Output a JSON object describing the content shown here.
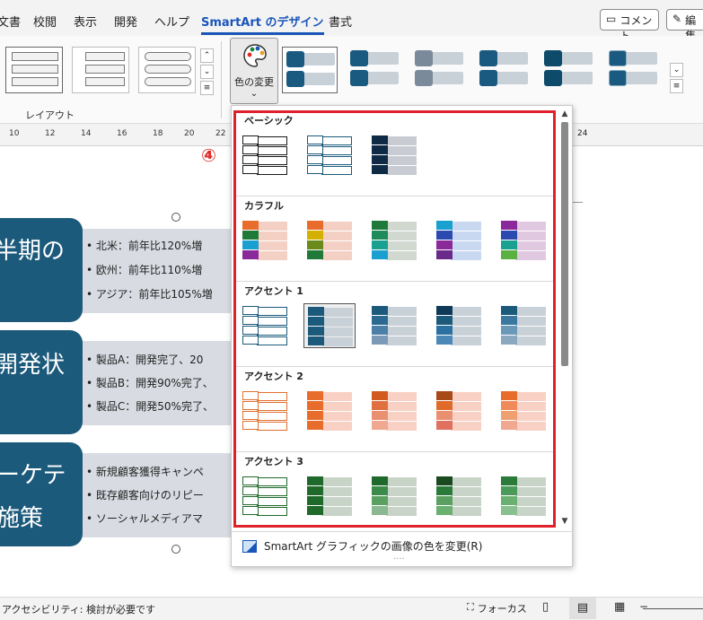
{
  "ribbon_tabs": [
    {
      "label": "文書",
      "active": false
    },
    {
      "label": "校閲",
      "active": false
    },
    {
      "label": "表示",
      "active": false
    },
    {
      "label": "開発",
      "active": false
    },
    {
      "label": "ヘルプ",
      "active": false
    },
    {
      "label": "SmartArt のデザイン",
      "active": true
    },
    {
      "label": "書式",
      "active": false
    }
  ],
  "comment_button": "コメント",
  "edit_button": "編集",
  "layout_group_label": "レイアウト",
  "color_change_button": "色の変更",
  "step_marker": "④",
  "ruler_ticks": [
    "10",
    "12",
    "14",
    "16",
    "18",
    "20",
    "22",
    "24"
  ],
  "document": {
    "blocks": [
      {
        "title_lines": [
          "半期の",
          ""
        ],
        "bullets": [
          "• 北米：前年比120%増",
          "• 欧州：前年比110%増",
          "• アジア：前年比105%増"
        ]
      },
      {
        "title_lines": [
          "開発状",
          ""
        ],
        "bullets": [
          "• 製品A：開発完了、20",
          "• 製品B：開発90%完了、",
          "• 製品C：開発50%完了、"
        ]
      },
      {
        "title_lines": [
          "ーケテ",
          "施策"
        ],
        "bullets": [
          "• 新規顧客獲得キャンペ",
          "• 既存顧客向けのリピー",
          "• ソーシャルメディアマ"
        ]
      }
    ]
  },
  "color_menu": {
    "sections": [
      {
        "title": "ベーシック",
        "options": [
          {
            "dark": "#ffffff",
            "light": "#ffffff",
            "border": "#1a1a1a",
            "rows": [
              "#ffffff",
              "#ffffff",
              "#ffffff",
              "#ffffff"
            ]
          },
          {
            "dark": "#ffffff",
            "light": "#ffffff",
            "border": "#1c5a7c",
            "rows": [
              "#ffffff",
              "#ffffff",
              "#ffffff",
              "#ffffff"
            ]
          },
          {
            "dark": "#0e2a44",
            "light": "#c8ccd2",
            "border": "none",
            "rows": [
              "#0e2a44",
              "#0e2a44",
              "#0e2a44",
              "#0e2a44"
            ]
          }
        ]
      },
      {
        "title": "カラフル",
        "options": [
          {
            "light": "#f4d0c4",
            "border": "none",
            "rows": [
              "#e86c2c",
              "#1f7a3a",
              "#1aa0d0",
              "#8a2a9a"
            ]
          },
          {
            "light": "#f4d0c4",
            "border": "none",
            "rows": [
              "#e86c2c",
              "#d4b000",
              "#6a8a1a",
              "#1f7a3a"
            ]
          },
          {
            "light": "#d0d8d0",
            "border": "none",
            "rows": [
              "#1f7a3a",
              "#1f8a5a",
              "#1aa090",
              "#1aa0d0"
            ]
          },
          {
            "light": "#c8d8f0",
            "border": "none",
            "rows": [
              "#1aa0d0",
              "#2a4ab0",
              "#8a2a9a",
              "#6a2a8a"
            ]
          },
          {
            "light": "#e0c8e0",
            "border": "none",
            "rows": [
              "#8a2a9a",
              "#2a4ab0",
              "#1aa090",
              "#5ab040"
            ]
          }
        ]
      },
      {
        "title": "アクセント 1",
        "options": [
          {
            "light": "#ffffff",
            "border": "#1c5a7c",
            "rows": [
              "#ffffff",
              "#ffffff",
              "#ffffff",
              "#ffffff"
            ]
          },
          {
            "light": "#c8d0d8",
            "border": "none",
            "selected": true,
            "rows": [
              "#1c5a7c",
              "#1c5a7c",
              "#1c5a7c",
              "#1c5a7c"
            ]
          },
          {
            "light": "#c8d0d8",
            "border": "none",
            "rows": [
              "#1c5a7c",
              "#2a6a90",
              "#4a80a8",
              "#7a9ab8"
            ]
          },
          {
            "light": "#c8d0d8",
            "border": "none",
            "rows": [
              "#0e3a58",
              "#1c5a7c",
              "#2a70a0",
              "#4a88b8"
            ]
          },
          {
            "light": "#c8d0d8",
            "border": "none",
            "rows": [
              "#1c5a7c",
              "#3a78a0",
              "#6a98b8",
              "#8aa8c0"
            ]
          }
        ]
      },
      {
        "title": "アクセント 2",
        "options": [
          {
            "light": "#ffffff",
            "border": "#e07030",
            "rows": [
              "#ffffff",
              "#ffffff",
              "#ffffff",
              "#ffffff"
            ]
          },
          {
            "light": "#f8d0c4",
            "border": "none",
            "rows": [
              "#e86c2c",
              "#e86c2c",
              "#e86c2c",
              "#e86c2c"
            ]
          },
          {
            "light": "#f8d0c4",
            "border": "none",
            "rows": [
              "#d05a20",
              "#e07040",
              "#e89070",
              "#f0a890"
            ]
          },
          {
            "light": "#f8d0c4",
            "border": "none",
            "rows": [
              "#a84a18",
              "#e06a2a",
              "#e89070",
              "#e07060"
            ]
          },
          {
            "light": "#f8d0c4",
            "border": "none",
            "rows": [
              "#e86c2c",
              "#f08a5a",
              "#f0a070",
              "#f0a890"
            ]
          }
        ]
      },
      {
        "title": "アクセント 3",
        "options": [
          {
            "light": "#ffffff",
            "border": "#1f6a2a",
            "rows": [
              "#ffffff",
              "#ffffff",
              "#ffffff",
              "#ffffff"
            ]
          },
          {
            "light": "#c8d4c8",
            "border": "none",
            "rows": [
              "#1f6a2a",
              "#1f6a2a",
              "#1f6a2a",
              "#1f6a2a"
            ]
          },
          {
            "light": "#c8d4c8",
            "border": "none",
            "rows": [
              "#1f6a2a",
              "#3a8a4a",
              "#5aa060",
              "#8ab890"
            ]
          },
          {
            "light": "#c8d4c8",
            "border": "none",
            "rows": [
              "#1a4a20",
              "#2a7a3a",
              "#5aa060",
              "#6ab070"
            ]
          },
          {
            "light": "#c8d4c8",
            "border": "none",
            "rows": [
              "#2a7a3a",
              "#4a9a5a",
              "#6ab070",
              "#8ac090"
            ]
          }
        ]
      }
    ],
    "recolor_pictures_label": "SmartArt グラフィックの画像の色を変更(R)",
    "highlight_color": "#e0202b"
  },
  "status_bar": {
    "accessibility": "アクセシビリティ: 検討が必要です",
    "focus_label": "フォーカス"
  },
  "accent_color": "#1a55b8",
  "smartart_dark_color": "#1c5a7c"
}
